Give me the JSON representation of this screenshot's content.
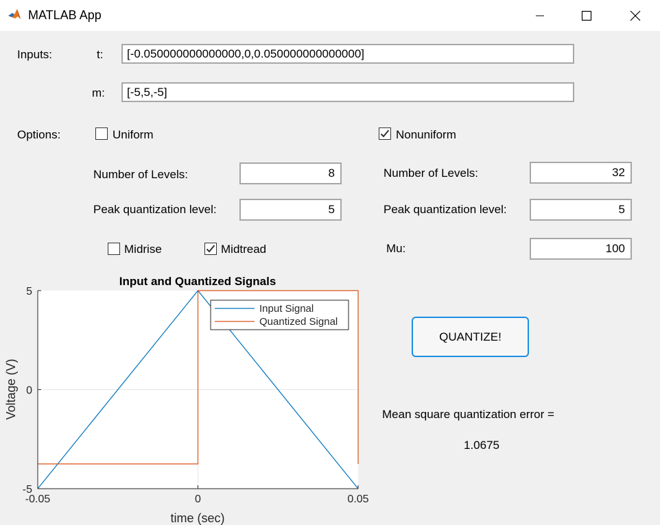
{
  "window": {
    "title": "MATLAB App",
    "icon": "matlab-logo-icon",
    "controls": [
      "minimize-icon",
      "maximize-icon",
      "close-icon"
    ]
  },
  "inputs": {
    "label": "Inputs:",
    "t_label": "t:",
    "t_value": "[-0.050000000000000,0,0.050000000000000]",
    "m_label": "m:",
    "m_value": "[-5,5,-5]"
  },
  "options": {
    "label": "Options:",
    "uniform": {
      "label": "Uniform",
      "checked": false,
      "levels_label": "Number of Levels:",
      "levels_value": "8",
      "peak_label": "Peak quantization level:",
      "peak_value": "5",
      "midrise_label": "Midrise",
      "midrise_checked": false,
      "midtread_label": "Midtread",
      "midtread_checked": true
    },
    "nonuniform": {
      "label": "Nonuniform",
      "checked": true,
      "levels_label": "Number of Levels:",
      "levels_value": "32",
      "peak_label": "Peak quantization level:",
      "peak_value": "5",
      "mu_label": "Mu:",
      "mu_value": "100"
    }
  },
  "actions": {
    "quantize_label": "QUANTIZE!"
  },
  "results": {
    "mse_label": "Mean square quantization error =",
    "mse_value": "1.0675"
  },
  "colors": {
    "input_signal": "#0072bd",
    "quantized_signal": "#d95319",
    "button_border": "#1a8fe3"
  },
  "chart_data": {
    "type": "line",
    "title": "Input and Quantized Signals",
    "xlabel": "time (sec)",
    "ylabel": "Voltage (V)",
    "xlim": [
      -0.05,
      0.05
    ],
    "ylim": [
      -5,
      5
    ],
    "xticks": [
      -0.05,
      0,
      0.05
    ],
    "xtick_labels": [
      "-0.05",
      "0",
      "0.05"
    ],
    "yticks": [
      -5,
      0,
      5
    ],
    "ytick_labels": [
      "-5",
      "0",
      "5"
    ],
    "grid": false,
    "legend_position": "top-right",
    "series": [
      {
        "name": "Input Signal",
        "color": "#0072bd",
        "x": [
          -0.05,
          0,
          0.05
        ],
        "y": [
          -5,
          5,
          -5
        ]
      },
      {
        "name": "Quantized Signal",
        "color": "#d95319",
        "x": [
          -0.05,
          0,
          0,
          0.05,
          0.05
        ],
        "y": [
          -3.75,
          -3.75,
          5,
          5,
          -3.75
        ]
      }
    ]
  }
}
